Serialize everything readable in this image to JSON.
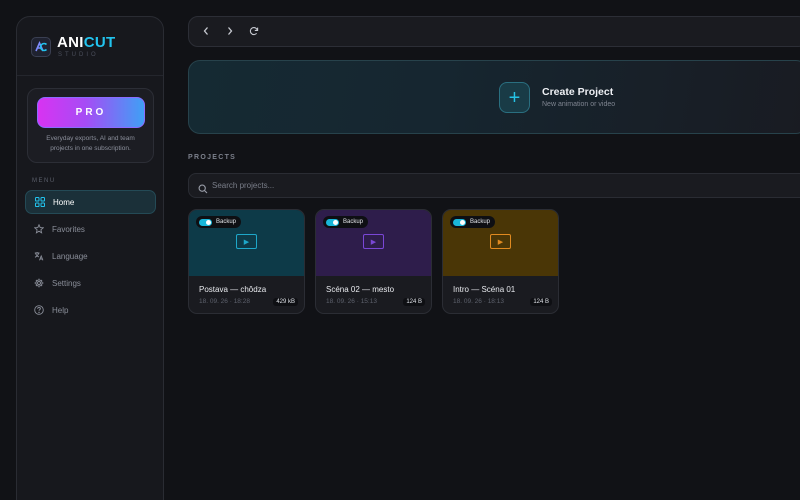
{
  "brand": {
    "name_a": "ANI",
    "name_b": "CUT",
    "subtitle": "STUDIO",
    "logo_text": "AC"
  },
  "pro": {
    "label": "PRO",
    "description": "Everyday exports, AI and team projects in one subscription."
  },
  "menu": {
    "label": "MENU",
    "items": [
      {
        "label": "Home",
        "icon": "grid-icon",
        "active": true
      },
      {
        "label": "Favorites",
        "icon": "star-icon",
        "active": false
      },
      {
        "label": "Language",
        "icon": "translate-icon",
        "active": false
      },
      {
        "label": "Settings",
        "icon": "gear-icon",
        "active": false
      },
      {
        "label": "Help",
        "icon": "help-icon",
        "active": false
      }
    ]
  },
  "toolbar": {
    "back_icon": "chevron-left-icon",
    "forward_icon": "chevron-right-icon",
    "reload_icon": "reload-icon"
  },
  "create": {
    "title": "Create Project",
    "subtitle": "New animation or video"
  },
  "projects": {
    "section_title": "PROJECTS",
    "search_placeholder": "Search projects...",
    "items": [
      {
        "title": "Postava — chôdza",
        "date": "18. 09. 26 · 18:28",
        "size": "429 kB",
        "backup_label": "Backup",
        "backup_on": true,
        "thumb_color": "#0d3a48",
        "accent": "#1ea7c9"
      },
      {
        "title": "Scéna 02 — mesto",
        "date": "18. 09. 26 · 15:13",
        "size": "124 B",
        "backup_label": "Backup",
        "backup_on": true,
        "thumb_color": "#2e1d4b",
        "accent": "#7a47d6"
      },
      {
        "title": "Intro — Scéna 01",
        "date": "18. 09. 26 · 18:13",
        "size": "124 B",
        "backup_label": "Backup",
        "backup_on": true,
        "thumb_color": "#4a3606",
        "accent": "#e08a20"
      }
    ]
  },
  "colors": {
    "accent": "#22c3ee",
    "background": "#111216"
  }
}
